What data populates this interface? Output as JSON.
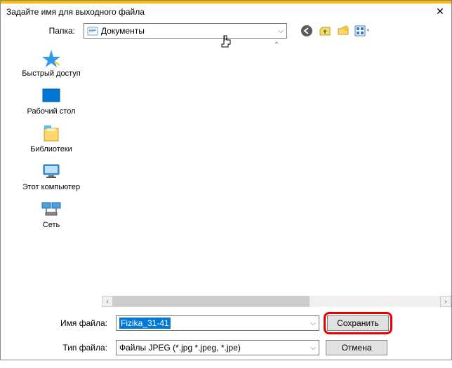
{
  "window": {
    "title": "Задайте имя для выходного файла"
  },
  "toprow": {
    "folder_label": "Папка:",
    "folder_value": "Документы"
  },
  "sidebar": {
    "items": [
      {
        "label": "Быстрый доступ"
      },
      {
        "label": "Рабочий стол"
      },
      {
        "label": "Библиотеки"
      },
      {
        "label": "Этот компьютер"
      },
      {
        "label": "Сеть"
      }
    ]
  },
  "bottom": {
    "filename_label": "Имя файла:",
    "filename_value": "Fizika_31-41",
    "filetype_label": "Тип файла:",
    "filetype_value": "Файлы JPEG (*.jpg *.jpeg, *.jpe)",
    "save_label": "Сохранить",
    "cancel_label": "Отмена"
  }
}
